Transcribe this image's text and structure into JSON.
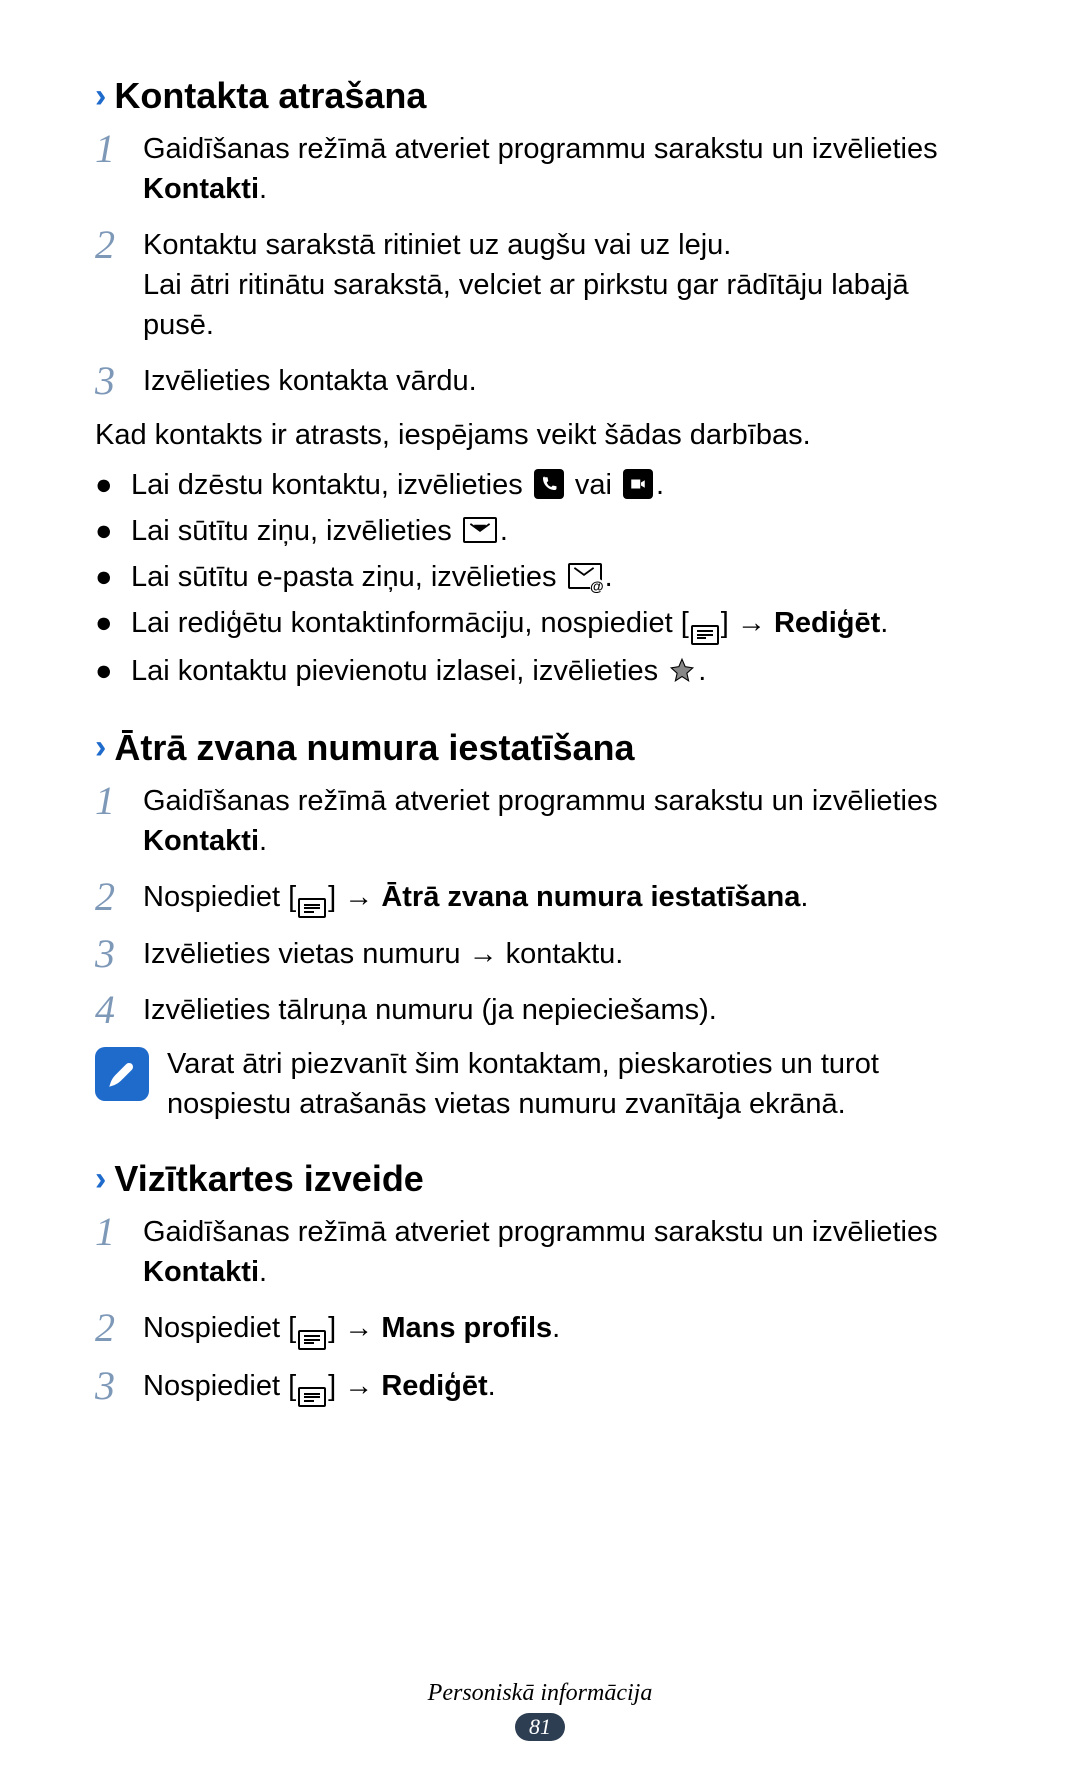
{
  "sections": {
    "s1": {
      "heading": "Kontakta atrašana",
      "steps": {
        "n1_num": "1",
        "n1_a": "Gaidīšanas režīmā atveriet programmu sarakstu un izvēlieties ",
        "n1_b": "Kontakti",
        "n1_c": ".",
        "n2_num": "2",
        "n2_a": "Kontaktu sarakstā ritiniet uz augšu vai uz leju.",
        "n2_b": "Lai ātri ritinātu sarakstā, velciet ar pirkstu gar rādītāju labajā pusē.",
        "n3_num": "3",
        "n3": "Izvēlieties kontakta vārdu."
      },
      "after": "Kad kontakts ir atrasts, iespējams veikt šādas darbības.",
      "bullets": {
        "dot": "●",
        "b1_a": "Lai dzēstu kontaktu, izvēlieties ",
        "b1_mid": " vai ",
        "b1_b": ".",
        "b2_a": "Lai sūtītu ziņu, izvēlieties ",
        "b2_b": ".",
        "b3_a": "Lai sūtītu e-pasta ziņu, izvēlieties ",
        "b3_b": ".",
        "b4_a": "Lai rediģētu kontaktinformāciju, nospiediet [",
        "b4_b": "] → ",
        "b4_c": "Rediģēt",
        "b4_d": ".",
        "b5_a": "Lai kontaktu pievienotu izlasei, izvēlieties ",
        "b5_b": "."
      }
    },
    "s2": {
      "heading": "Ātrā zvana numura iestatīšana",
      "steps": {
        "n1_num": "1",
        "n1_a": "Gaidīšanas režīmā atveriet programmu sarakstu un izvēlieties ",
        "n1_b": "Kontakti",
        "n1_c": ".",
        "n2_num": "2",
        "n2_a": "Nospiediet [",
        "n2_b": "] → ",
        "n2_c": "Ātrā zvana numura iestatīšana",
        "n2_d": ".",
        "n3_num": "3",
        "n3": "Izvēlieties vietas numuru → kontaktu.",
        "n4_num": "4",
        "n4": "Izvēlieties tālruņa numuru (ja nepieciešams)."
      },
      "note": "Varat ātri piezvanīt šim kontaktam, pieskaroties un turot nospiestu atrašanās vietas numuru zvanītāja ekrānā."
    },
    "s3": {
      "heading": "Vizītkartes izveide",
      "steps": {
        "n1_num": "1",
        "n1_a": "Gaidīšanas režīmā atveriet programmu sarakstu un izvēlieties ",
        "n1_b": "Kontakti",
        "n1_c": ".",
        "n2_num": "2",
        "n2_a": "Nospiediet [",
        "n2_b": "] → ",
        "n2_c": "Mans profils",
        "n2_d": ".",
        "n3_num": "3",
        "n3_a": "Nospiediet [",
        "n3_b": "] → ",
        "n3_c": "Rediģēt",
        "n3_d": "."
      }
    }
  },
  "footer": {
    "label": "Personiskā informācija",
    "page": "81"
  },
  "chevron": "›"
}
